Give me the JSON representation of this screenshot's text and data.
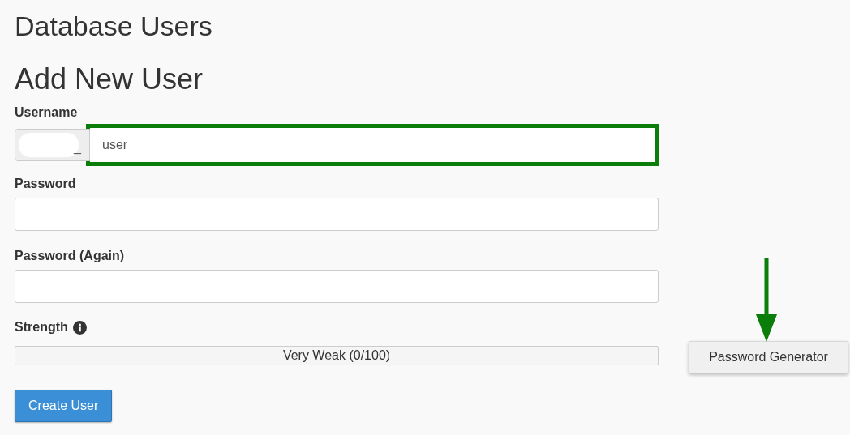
{
  "page_title": "Database Users",
  "section_title": "Add New User",
  "username": {
    "label": "Username",
    "prefix": "_",
    "prefix_redacted": true,
    "value": "user",
    "highlighted": true
  },
  "password_fields": [
    {
      "label": "Password"
    },
    {
      "label": "Password (Again)"
    }
  ],
  "strength": {
    "label": "Strength",
    "level": 0,
    "reading": "Very Weak (0/100)"
  },
  "password_generator": {
    "label": "Password Generator",
    "arrow": true
  },
  "submit_button": "Create User"
}
